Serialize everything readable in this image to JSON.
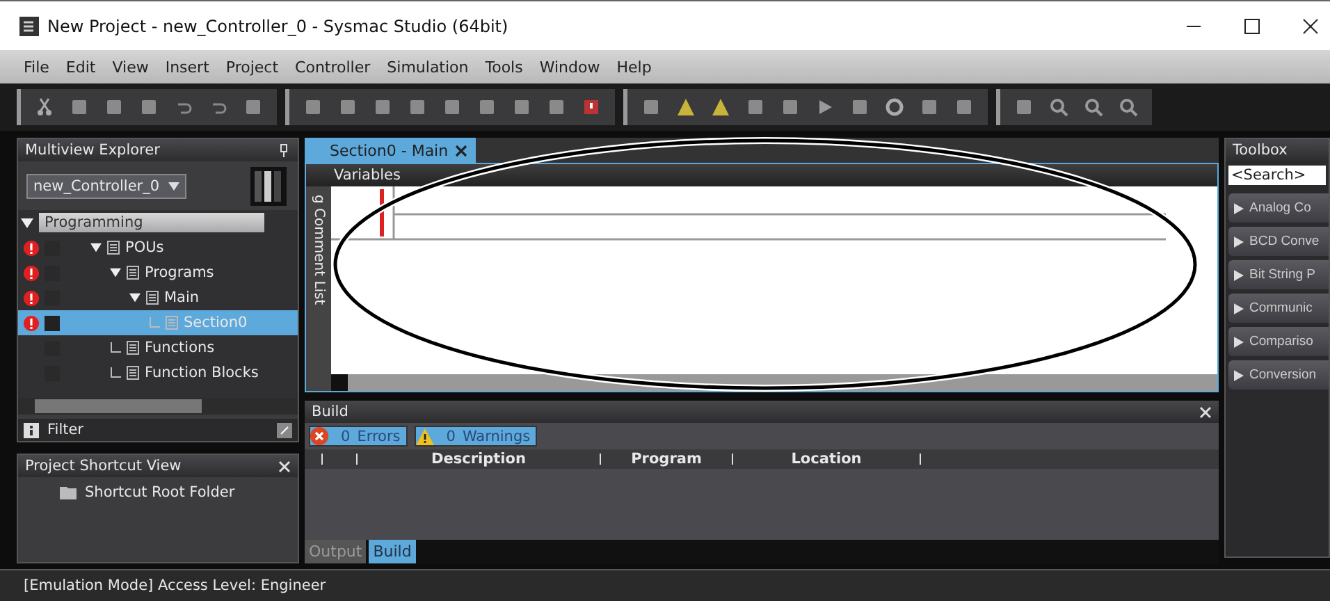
{
  "window": {
    "title": "New Project - new_Controller_0 - Sysmac Studio (64bit)"
  },
  "menu": [
    "File",
    "Edit",
    "View",
    "Insert",
    "Project",
    "Controller",
    "Simulation",
    "Tools",
    "Window",
    "Help"
  ],
  "explorer": {
    "title": "Multiview Explorer",
    "controller": "new_Controller_0",
    "filter": "Filter",
    "tree": [
      {
        "label": "Programming",
        "kind": "header",
        "expanded": true,
        "selected": false,
        "children": [
          {
            "label": "POUs",
            "kind": "item",
            "expanded": true,
            "error": true,
            "selected": false,
            "children": [
              {
                "label": "Programs",
                "kind": "item",
                "expanded": true,
                "error": true,
                "selected": false,
                "children": [
                  {
                    "label": "Main",
                    "kind": "item",
                    "expanded": true,
                    "error": true,
                    "selected": false,
                    "children": [
                      {
                        "label": "Section0",
                        "kind": "item",
                        "error": true,
                        "selected": true
                      }
                    ]
                  }
                ]
              },
              {
                "label": "Functions",
                "kind": "item",
                "error": false,
                "selected": false
              },
              {
                "label": "Function Blocks",
                "kind": "item",
                "error": false,
                "selected": false
              }
            ]
          }
        ]
      }
    ]
  },
  "shortcut_view": {
    "title": "Project Shortcut View",
    "items": [
      "Shortcut Root Folder"
    ]
  },
  "editor": {
    "tabs": [
      {
        "label": "Section0 - Main",
        "selected": true
      }
    ],
    "variables_label": "Variables",
    "side_label": "g Comment List"
  },
  "build": {
    "title": "Build",
    "filters": [
      {
        "kind": "error",
        "count": "0",
        "label": "Errors",
        "on": true
      },
      {
        "kind": "warning",
        "count": "0",
        "label": "Warnings",
        "on": true
      }
    ],
    "columns": [
      "Description",
      "Program",
      "Location"
    ],
    "tabs": [
      {
        "label": "Output",
        "selected": false
      },
      {
        "label": "Build",
        "selected": true
      }
    ]
  },
  "toolbox": {
    "title": "Toolbox",
    "search": {
      "placeholder": "<Search>"
    },
    "items": [
      "Analog Co",
      "BCD Conve",
      "Bit String P",
      "Communic",
      "Compariso",
      "Conversion"
    ]
  },
  "status_bar": "[Emulation Mode] Access Level: Engineer"
}
